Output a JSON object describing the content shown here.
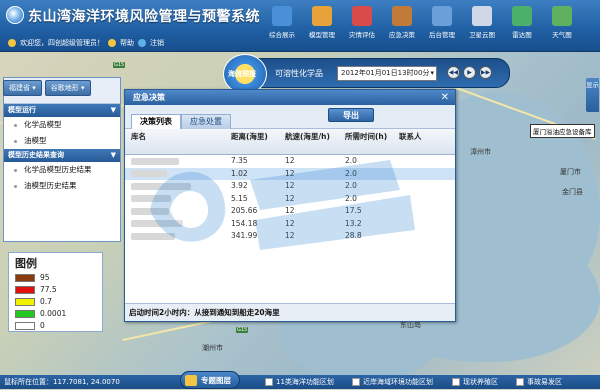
{
  "header": {
    "title": "东山湾海洋环境风险管理与预警系统",
    "welcome": "欢迎您，四创超级管理员！",
    "help": "帮助",
    "logout": "注销"
  },
  "nav": [
    {
      "label": "综合展示",
      "icon": "display-icon",
      "color": "#4a90d9"
    },
    {
      "label": "模型管理",
      "icon": "folder-icon",
      "color": "#e8a23a"
    },
    {
      "label": "灾情评估",
      "icon": "document-icon",
      "color": "#d94a4a"
    },
    {
      "label": "应急决策",
      "icon": "briefcase-icon",
      "color": "#c07a3a"
    },
    {
      "label": "后台管理",
      "icon": "computer-icon",
      "color": "#6aa0d8"
    },
    {
      "label": "卫星云图",
      "icon": "satellite-icon",
      "color": "#d0d8e8"
    },
    {
      "label": "雷达图",
      "icon": "radar-icon",
      "color": "#4ab06a"
    },
    {
      "label": "天气图",
      "icon": "map-icon",
      "color": "#5fb05f"
    }
  ],
  "left_panel": {
    "top_buttons": [
      "福建省",
      "谷歌地形"
    ],
    "section1": {
      "title": "模型运行",
      "items": [
        "化学品模型",
        "油模型"
      ]
    },
    "section2": {
      "title": "模型历史结果查询",
      "items": [
        "化学品模型历史结果",
        "油模型历史结果"
      ]
    }
  },
  "legend": {
    "title": "图例",
    "entries": [
      {
        "label": "95",
        "color": "#8b3a0e"
      },
      {
        "label": "77.5",
        "color": "#e01010"
      },
      {
        "label": "0.7",
        "color": "#f2f200"
      },
      {
        "label": "0.0001",
        "color": "#22c822"
      },
      {
        "label": "0",
        "color": "#ffffff"
      }
    ]
  },
  "timebar": {
    "badge": "海流预报",
    "label": "可溶性化学品",
    "datetime": "2012年01月01日13时00分",
    "controls": [
      "◀◀",
      "▶",
      "▶▶"
    ]
  },
  "dialog": {
    "title": "应急决策",
    "close": "✕",
    "tabs": [
      "决策列表",
      "应急处置"
    ],
    "export": "导出",
    "columns": [
      "库名",
      "距离(海里)",
      "航速(海里/h)",
      "所需时间(h)",
      "联系人"
    ],
    "rows": [
      {
        "distance": "7.35",
        "speed": "12",
        "time": "2.0"
      },
      {
        "distance": "1.02",
        "speed": "12",
        "time": "2.0"
      },
      {
        "distance": "3.92",
        "speed": "12",
        "time": "2.0"
      },
      {
        "distance": "5.15",
        "speed": "12",
        "time": "2.0"
      },
      {
        "distance": "205.66",
        "speed": "12",
        "time": "17.5"
      },
      {
        "distance": "154.18",
        "speed": "12",
        "time": "13.2"
      },
      {
        "distance": "341.99",
        "speed": "12",
        "time": "28.8"
      }
    ],
    "footer": "启动时间2小时内：从接到通知到船走20海里"
  },
  "map": {
    "tooltip": "厦门溢油应急设备库",
    "right_tab": "显示",
    "cities": [
      "潮州市",
      "东山岛",
      "汕头市",
      "漳州市",
      "厦门市",
      "金门县"
    ]
  },
  "statusbar": {
    "coords": "鼠标所在位置：117.7081, 24.0070",
    "layer_button": "专题图层",
    "checks": [
      "11类海洋功能区划",
      "近岸海域环境功能区划",
      "现状养殖区",
      "事故易发区"
    ]
  }
}
